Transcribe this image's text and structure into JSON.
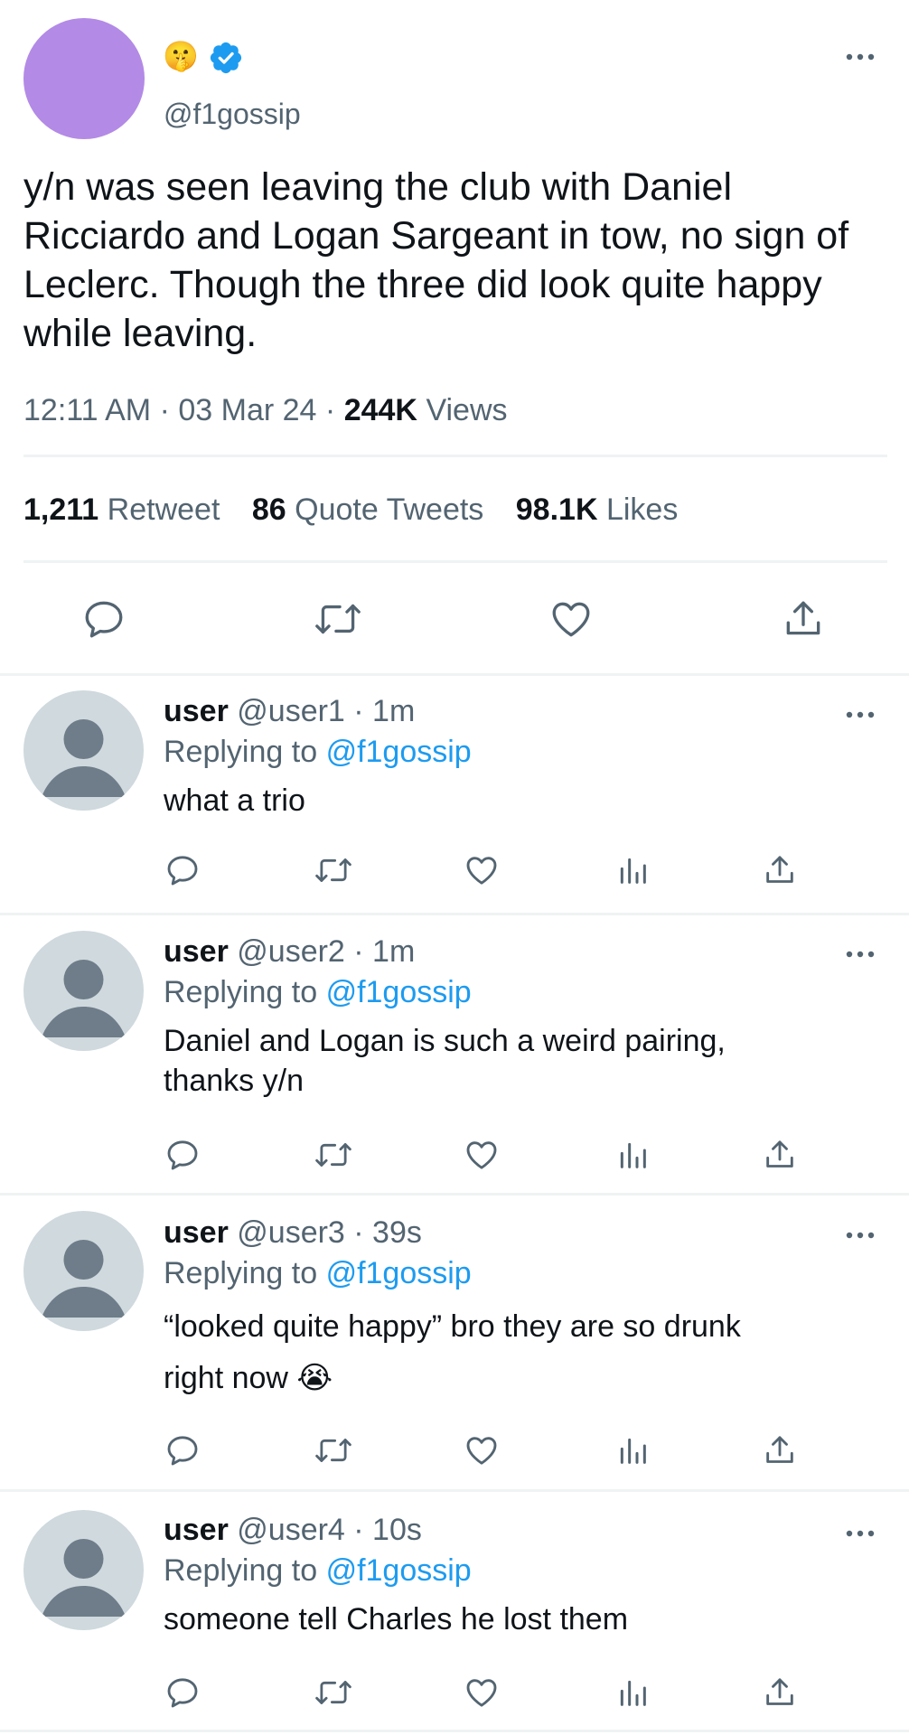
{
  "tweet": {
    "avatar_color": "#b38ae6",
    "emoji": "🤫",
    "handle": "@f1gossip",
    "text": "y/n was seen leaving the club with Daniel Ricciardo and Logan Sargeant in tow, no sign of Leclerc. Though the three did look quite happy while leaving.",
    "time": "12:11 AM",
    "dot1": "·",
    "date": "03 Mar 24",
    "dot2": "·",
    "views_count": "244K",
    "views_label": "Views",
    "stats": {
      "retweets_count": "1,211",
      "retweets_label": "Retweet",
      "quotes_count": "86",
      "quotes_label": "Quote Tweets",
      "likes_count": "98.1K",
      "likes_label": "Likes"
    }
  },
  "replies": [
    {
      "name": "user",
      "meta": "@user1 · 1m",
      "replying_label": "Replying to",
      "replying_handle": "@f1gossip",
      "text": "what a trio",
      "text2": ""
    },
    {
      "name": "user",
      "meta": "@user2 · 1m",
      "replying_label": "Replying to",
      "replying_handle": "@f1gossip",
      "text": "Daniel and Logan is such a weird pairing,",
      "text2": "thanks y/n"
    },
    {
      "name": "user",
      "meta": "@user3 · 39s",
      "replying_label": "Replying to",
      "replying_handle": "@f1gossip",
      "text": "“looked quite happy” bro they are so drunk",
      "text2": "right now 😭"
    },
    {
      "name": "user",
      "meta": "@user4 · 10s",
      "replying_label": "Replying to",
      "replying_handle": "@f1gossip",
      "text": "someone tell Charles he lost them",
      "text2": ""
    }
  ],
  "colors": {
    "text": "#0f1419",
    "secondary": "#536471",
    "link": "#1d9bf0",
    "divider": "#eff3f4",
    "avatar_placeholder": "#cfd9de",
    "avatar_silhouette": "#6e7d89"
  },
  "icons": [
    "more-icon",
    "verified-icon",
    "reply-icon",
    "retweet-icon",
    "like-icon",
    "share-icon",
    "analytics-icon"
  ]
}
